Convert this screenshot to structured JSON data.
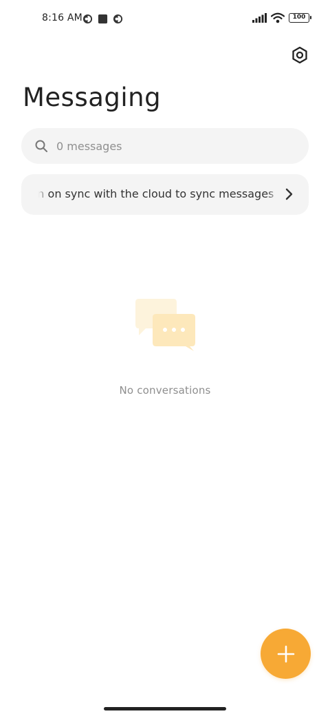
{
  "status_bar": {
    "time": "8:16 AM",
    "battery": "100",
    "icons": [
      "notification-icon",
      "stop-square-icon",
      "notification-icon",
      "signal-icon",
      "wifi-icon",
      "battery-icon"
    ]
  },
  "header": {
    "title": "Messaging",
    "settings_icon": "settings-hexagon-icon"
  },
  "search": {
    "placeholder": "0 messages",
    "value": ""
  },
  "sync_banner": {
    "text": "rn on sync with the cloud to sync messages",
    "chevron_icon": "chevron-right-icon"
  },
  "empty_state": {
    "icon": "chat-bubbles-icon",
    "text": "No conversations"
  },
  "fab": {
    "icon": "plus-icon"
  },
  "colors": {
    "accent": "#f7a935",
    "surface": "#f4f4f4",
    "text_primary": "#222222",
    "text_secondary": "#8e8e8e",
    "illustration_light": "#fdf3dc",
    "illustration_medium": "#fde8bb"
  }
}
